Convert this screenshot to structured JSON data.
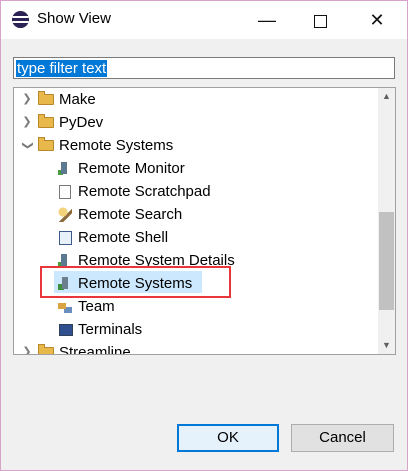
{
  "window": {
    "title": "Show View",
    "minimize_label": "—",
    "close_label": "✕"
  },
  "filter": {
    "value": "type filter text"
  },
  "tree": {
    "items": [
      {
        "label": "Make",
        "kind": "folder",
        "expanded": false,
        "icon": "folder-icon"
      },
      {
        "label": "PyDev",
        "kind": "folder",
        "expanded": false,
        "icon": "folder-icon"
      },
      {
        "label": "Remote Systems",
        "kind": "folder",
        "expanded": true,
        "icon": "folder-open-icon"
      },
      {
        "label": "Remote Monitor",
        "kind": "view",
        "icon": "remote-monitor-icon"
      },
      {
        "label": "Remote Scratchpad",
        "kind": "view",
        "icon": "scratchpad-icon"
      },
      {
        "label": "Remote Search",
        "kind": "view",
        "icon": "remote-search-icon"
      },
      {
        "label": "Remote Shell",
        "kind": "view",
        "icon": "remote-shell-icon"
      },
      {
        "label": "Remote System Details",
        "kind": "view",
        "icon": "system-details-icon"
      },
      {
        "label": "Remote Systems",
        "kind": "view",
        "icon": "remote-systems-icon",
        "selected": true,
        "highlighted": true
      },
      {
        "label": "Team",
        "kind": "view",
        "icon": "team-icon"
      },
      {
        "label": "Terminals",
        "kind": "view",
        "icon": "terminals-icon"
      },
      {
        "label": "Streamline",
        "kind": "folder",
        "expanded": false,
        "icon": "folder-icon"
      }
    ]
  },
  "buttons": {
    "ok": "OK",
    "cancel": "Cancel"
  },
  "colors": {
    "selection": "#cce8ff",
    "highlight": "#e8363a",
    "accent": "#0078d7"
  }
}
